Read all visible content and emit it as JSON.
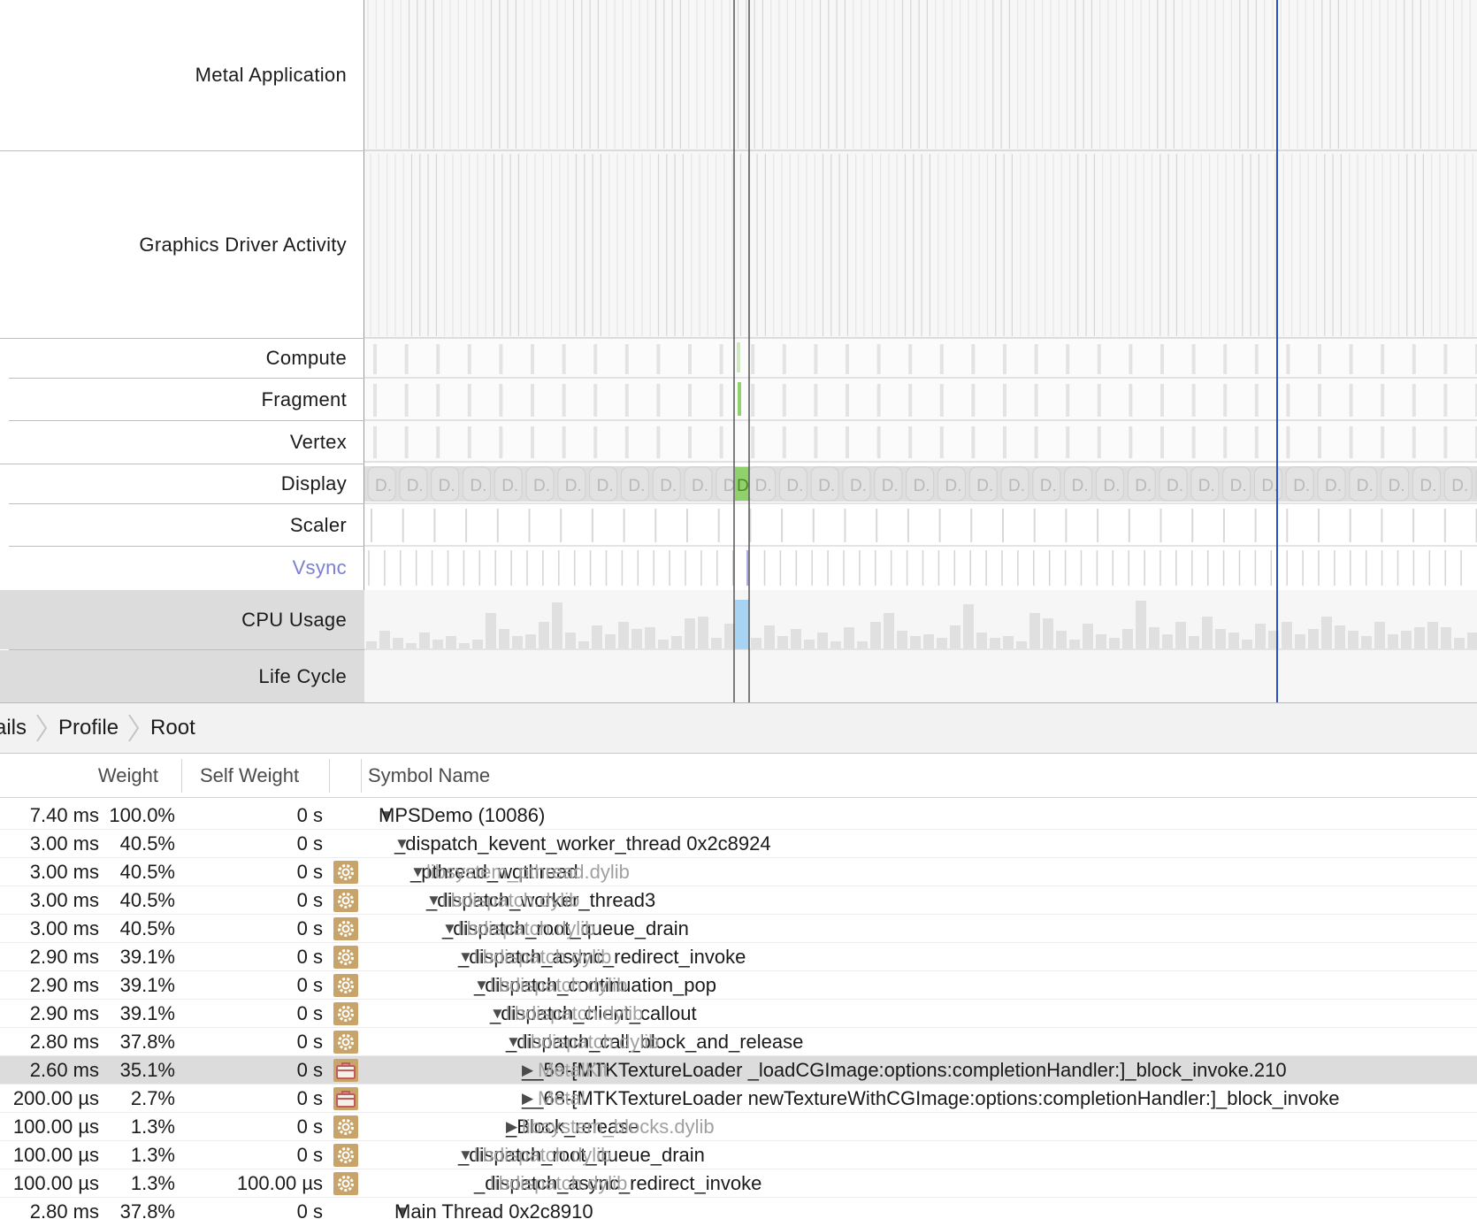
{
  "tracks": [
    {
      "id": "metal-application",
      "label": "Metal Application"
    },
    {
      "id": "graphics-driver-activity",
      "label": "Graphics Driver Activity"
    },
    {
      "id": "compute",
      "label": "Compute"
    },
    {
      "id": "fragment",
      "label": "Fragment"
    },
    {
      "id": "vertex",
      "label": "Vertex"
    },
    {
      "id": "display",
      "label": "Display"
    },
    {
      "id": "scaler",
      "label": "Scaler"
    },
    {
      "id": "vsync",
      "label": "Vsync"
    },
    {
      "id": "cpu-usage",
      "label": "CPU Usage"
    },
    {
      "id": "life-cycle",
      "label": "Life Cycle"
    }
  ],
  "display_block_label": "D.",
  "display_selected_label": "D",
  "colors": {
    "selected_green": "#8fd16a",
    "cpu_selected": "#a6d4f2",
    "cursor_blue": "#2b4fc7",
    "vsync_text": "#7a7fd1"
  },
  "breadcrumb": [
    "ails",
    "Profile",
    "Root"
  ],
  "columns": {
    "weight": "Weight",
    "self_weight": "Self Weight",
    "symbol_name": "Symbol Name"
  },
  "rows": [
    {
      "weight_ms": "7.40 ms",
      "weight_pct": "100.0%",
      "self": "0 s",
      "icon": "",
      "indent": 0,
      "expand": "down",
      "symbol": "MPSDemo (10086)",
      "lib": ""
    },
    {
      "weight_ms": "3.00 ms",
      "weight_pct": "40.5%",
      "self": "0 s",
      "icon": "",
      "indent": 1,
      "expand": "down",
      "symbol": "_dispatch_kevent_worker_thread  0x2c8924",
      "lib": ""
    },
    {
      "weight_ms": "3.00 ms",
      "weight_pct": "40.5%",
      "self": "0 s",
      "icon": "gear",
      "indent": 2,
      "expand": "down",
      "symbol": "_pthread_wqthread",
      "lib": "libsystem_pthread.dylib"
    },
    {
      "weight_ms": "3.00 ms",
      "weight_pct": "40.5%",
      "self": "0 s",
      "icon": "gear",
      "indent": 3,
      "expand": "down",
      "symbol": "_dispatch_worker_thread3",
      "lib": "libdispatch.dylib"
    },
    {
      "weight_ms": "3.00 ms",
      "weight_pct": "40.5%",
      "self": "0 s",
      "icon": "gear",
      "indent": 4,
      "expand": "down",
      "symbol": "_dispatch_root_queue_drain",
      "lib": "libdispatch.dylib"
    },
    {
      "weight_ms": "2.90 ms",
      "weight_pct": "39.1%",
      "self": "0 s",
      "icon": "gear",
      "indent": 5,
      "expand": "down",
      "symbol": "_dispatch_async_redirect_invoke",
      "lib": "libdispatch.dylib"
    },
    {
      "weight_ms": "2.90 ms",
      "weight_pct": "39.1%",
      "self": "0 s",
      "icon": "gear",
      "indent": 6,
      "expand": "down",
      "symbol": "_dispatch_continuation_pop",
      "lib": "libdispatch.dylib"
    },
    {
      "weight_ms": "2.90 ms",
      "weight_pct": "39.1%",
      "self": "0 s",
      "icon": "gear",
      "indent": 7,
      "expand": "down",
      "symbol": "_dispatch_client_callout",
      "lib": "libdispatch.dylib"
    },
    {
      "weight_ms": "2.80 ms",
      "weight_pct": "37.8%",
      "self": "0 s",
      "icon": "gear",
      "indent": 8,
      "expand": "down",
      "symbol": "_dispatch_call_block_and_release",
      "lib": "libdispatch.dylib"
    },
    {
      "weight_ms": "2.60 ms",
      "weight_pct": "35.1%",
      "self": "0 s",
      "icon": "toolbox",
      "indent": 9,
      "expand": "right",
      "symbol": "__59-[MTKTextureLoader _loadCGImage:options:completionHandler:]_block_invoke.210",
      "lib": "MetalKit",
      "selected": true
    },
    {
      "weight_ms": "200.00 µs",
      "weight_pct": "2.7%",
      "self": "0 s",
      "icon": "toolbox",
      "indent": 9,
      "expand": "right",
      "symbol": "__68-[MTKTextureLoader newTextureWithCGImage:options:completionHandler:]_block_invoke",
      "lib": "Metal"
    },
    {
      "weight_ms": "100.00 µs",
      "weight_pct": "1.3%",
      "self": "0 s",
      "icon": "gear",
      "indent": 8,
      "expand": "right",
      "symbol": "_Block_release",
      "lib": "libsystem_blocks.dylib"
    },
    {
      "weight_ms": "100.00 µs",
      "weight_pct": "1.3%",
      "self": "0 s",
      "icon": "gear",
      "indent": 5,
      "expand": "down",
      "symbol": "_dispatch_root_queue_drain",
      "lib": "libdispatch.dylib"
    },
    {
      "weight_ms": "100.00 µs",
      "weight_pct": "1.3%",
      "self": "100.00 µs",
      "icon": "gear",
      "indent": 6,
      "expand": "none",
      "symbol": "_dispatch_async_redirect_invoke",
      "lib": "libdispatch.dylib"
    },
    {
      "weight_ms": "2.80 ms",
      "weight_pct": "37.8%",
      "self": "0 s",
      "icon": "",
      "indent": 1,
      "expand": "down",
      "symbol": "Main Thread  0x2c8910",
      "lib": ""
    }
  ]
}
